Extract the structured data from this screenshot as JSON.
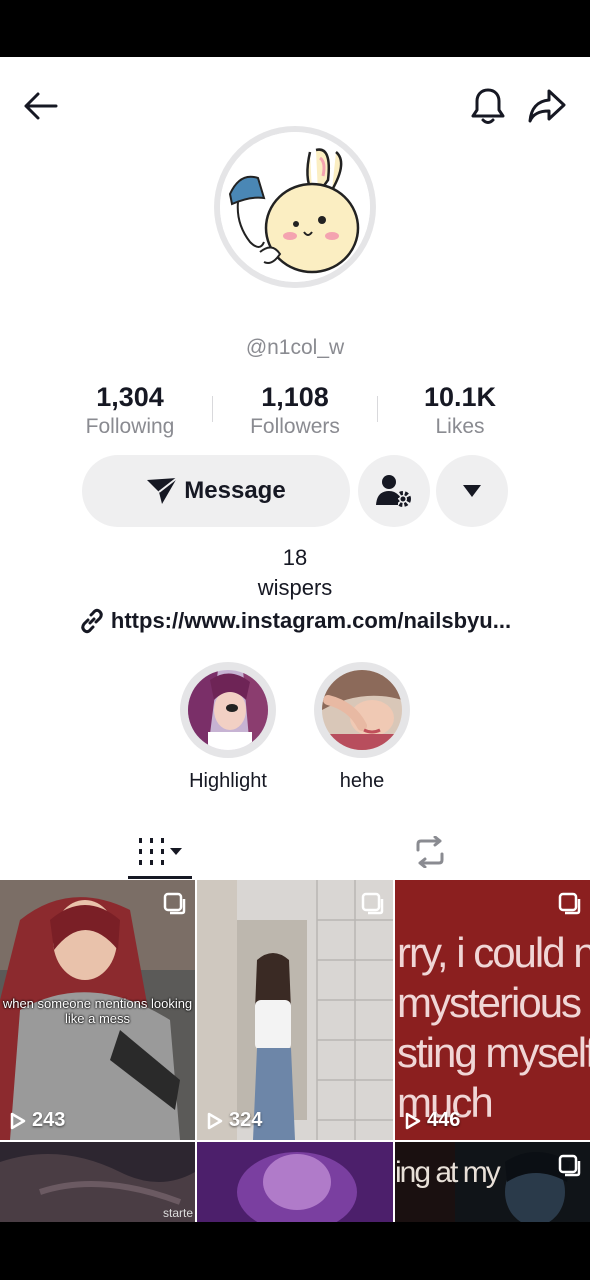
{
  "profile": {
    "username": "@n1col_w",
    "avatar_icon": "bunny-sticker-avatar"
  },
  "stats": [
    {
      "value": "1,304",
      "label": "Following"
    },
    {
      "value": "1,108",
      "label": "Followers"
    },
    {
      "value": "10.1K",
      "label": "Likes"
    }
  ],
  "actions": {
    "message_label": "Message",
    "message_icon": "paper-plane-icon",
    "add_friend_icon": "user-settings-icon",
    "more_icon": "caret-down-icon"
  },
  "bio": {
    "line1": "18",
    "line2": "wispers",
    "link": "https://www.instagram.com/nailsbyu..."
  },
  "highlights": [
    {
      "label": "Highlight"
    },
    {
      "label": "hehe"
    }
  ],
  "tabs": {
    "videos_icon": "grid-filter-icon",
    "reposts_icon": "repost-icon"
  },
  "videos": [
    {
      "views": "243",
      "caption": "when someone mentions looking like a mess"
    },
    {
      "views": "324"
    },
    {
      "views": "446",
      "caption": "rry, i could ne mysterious i l sting myself t much"
    },
    {
      "caption": "starte"
    },
    {},
    {
      "caption": "ing at my"
    }
  ],
  "colors": {
    "text_primary": "#161823",
    "text_secondary": "#8a8b91",
    "button_bg": "#efeff0"
  }
}
